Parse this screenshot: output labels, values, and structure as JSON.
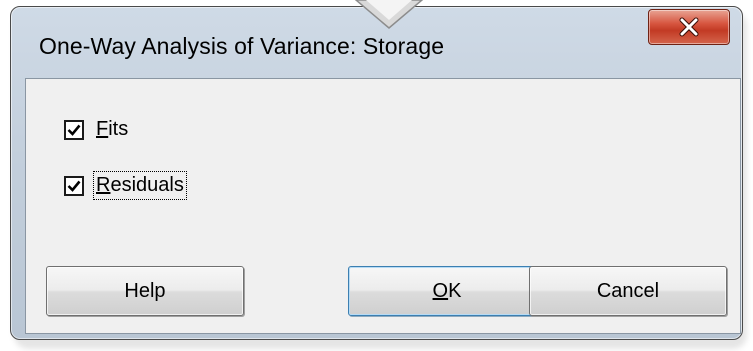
{
  "window": {
    "title": "One-Way Analysis of Variance: Storage",
    "close_icon": "close-x-icon"
  },
  "options": [
    {
      "label_mnemonic": "F",
      "label_rest": "its",
      "checked": true
    },
    {
      "label_mnemonic": "R",
      "label_rest": "esiduals",
      "checked": true
    }
  ],
  "buttons": {
    "help": {
      "label": "Help"
    },
    "ok": {
      "label_mnemonic": "O",
      "label_rest": "K"
    },
    "cancel": {
      "label": "Cancel"
    }
  },
  "colors": {
    "close_button": "#c9432d",
    "frame": "#c3cfdc",
    "client": "#f0f0f0"
  }
}
